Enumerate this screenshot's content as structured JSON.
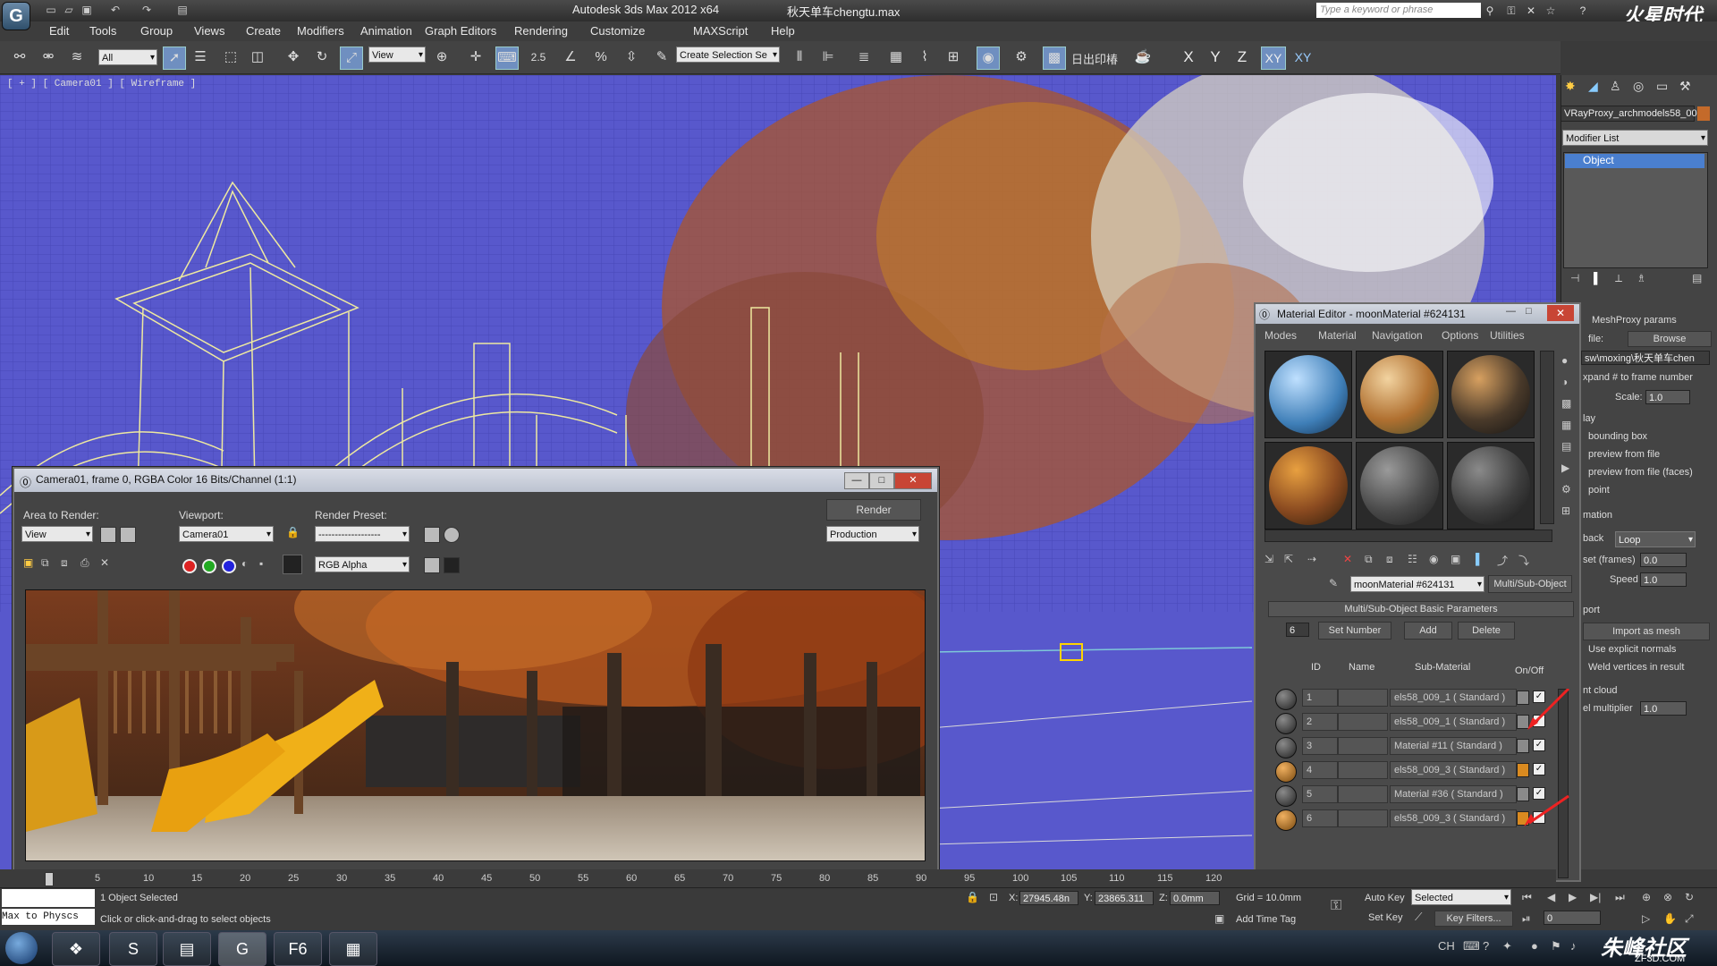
{
  "titlebar": {
    "title": "Autodesk 3ds Max  2012 x64",
    "file": "秋天单车chengtu.max",
    "search_placeholder": "Type a keyword or phrase",
    "logo": "火星时代"
  },
  "menu": [
    "Edit",
    "Tools",
    "Group",
    "Views",
    "Create",
    "Modifiers",
    "Animation",
    "Graph Editors",
    "Rendering",
    "Customize",
    "MAXScript",
    "Help"
  ],
  "toolbar": {
    "filter": "All",
    "ref_coord": "View",
    "snap_angle": "2.5",
    "selection_set": "Create Selection Se",
    "extra_label": "日出印椿",
    "axes": [
      "X",
      "Y",
      "Z",
      "XY",
      "XY"
    ]
  },
  "viewport": {
    "label": "[ + ] [ Camera01 ] [ Wireframe ]"
  },
  "render_window": {
    "title": "Camera01, frame 0, RGBA Color 16 Bits/Channel (1:1)",
    "area_to_render_label": "Area to Render:",
    "area_to_render": "View",
    "viewport_label": "Viewport:",
    "viewport": "Camera01",
    "preset_label": "Render Preset:",
    "preset": "-------------------",
    "render_button": "Render",
    "production": "Production",
    "channel": "RGB Alpha"
  },
  "material_editor": {
    "title": "Material Editor - moonMaterial #624131",
    "menus": [
      "Modes",
      "Material",
      "Navigation",
      "Options",
      "Utilities"
    ],
    "material_name": "moonMaterial #624131",
    "material_type": "Multi/Sub-Object",
    "rollout": "Multi/Sub-Object Basic Parameters",
    "count": "6",
    "set_number": "Set Number",
    "add": "Add",
    "delete": "Delete",
    "headers": {
      "id": "ID",
      "name": "Name",
      "sub": "Sub-Material",
      "onoff": "On/Off"
    },
    "rows": [
      {
        "id": "1",
        "sub": "els58_009_1  ( Standard )",
        "color": "#8a8a8a"
      },
      {
        "id": "2",
        "sub": "els58_009_1  ( Standard )",
        "color": "#8a8a8a"
      },
      {
        "id": "3",
        "sub": "Material #11  ( Standard )",
        "color": "#8a8a8a"
      },
      {
        "id": "4",
        "sub": "els58_009_3  ( Standard )",
        "color": "#d98a20"
      },
      {
        "id": "5",
        "sub": "Material #36  ( Standard )",
        "color": "#8a8a8a"
      },
      {
        "id": "6",
        "sub": "els58_009_3  ( Standard )",
        "color": "#d98a20"
      }
    ]
  },
  "command_panel": {
    "object_name": "VRayProxy_archmodels58_00",
    "modifier_list": "Modifier List",
    "stack_item": "Object",
    "rollout": "MeshProxy params",
    "file_label": "file:",
    "browse": "Browse",
    "path": "sw\\moxing\\秋天单车chen",
    "expand": "xpand # to frame number",
    "scale_label": "Scale:",
    "scale": "1.0",
    "display_label": "lay",
    "display_options": [
      "bounding box",
      "preview from file",
      "preview from file (faces)",
      "point"
    ],
    "animation_label": "mation",
    "playback_label": "back",
    "playback": "Loop",
    "offset_label": "set (frames)",
    "offset": "0.0",
    "speed_label": "Speed",
    "speed": "1.0",
    "import_label": "port",
    "import_mesh": "Import as mesh",
    "explicit_normals": "Use explicit normals",
    "weld_vertices": "Weld vertices in result",
    "cloud_label": "nt cloud",
    "multiplier_label": "el multiplier",
    "multiplier": "1.0"
  },
  "timeline": {
    "ticks": [
      "0",
      "5",
      "10",
      "15",
      "20",
      "25",
      "30",
      "35",
      "40",
      "45",
      "50",
      "55",
      "60",
      "65",
      "70",
      "75",
      "80",
      "85",
      "90",
      "95",
      "100",
      "105",
      "110",
      "115",
      "120"
    ]
  },
  "status": {
    "script_box": "Max to Physcs",
    "selected": "1 Object Selected",
    "prompt": "Click or click-and-drag to select objects",
    "x_label": "X:",
    "x": "27945.48n",
    "y_label": "Y:",
    "y": "23865.311",
    "z_label": "Z:",
    "z": "0.0mm",
    "grid": "Grid = 10.0mm",
    "auto_key": "Auto Key",
    "set_key": "Set Key",
    "selected_dropdown": "Selected",
    "key_filters": "Key Filters...",
    "add_time_tag": "Add Time Tag",
    "frame": "0"
  },
  "taskbar": {
    "watermark": "朱峰社区",
    "watermark_url": "ZF3D.COM"
  }
}
